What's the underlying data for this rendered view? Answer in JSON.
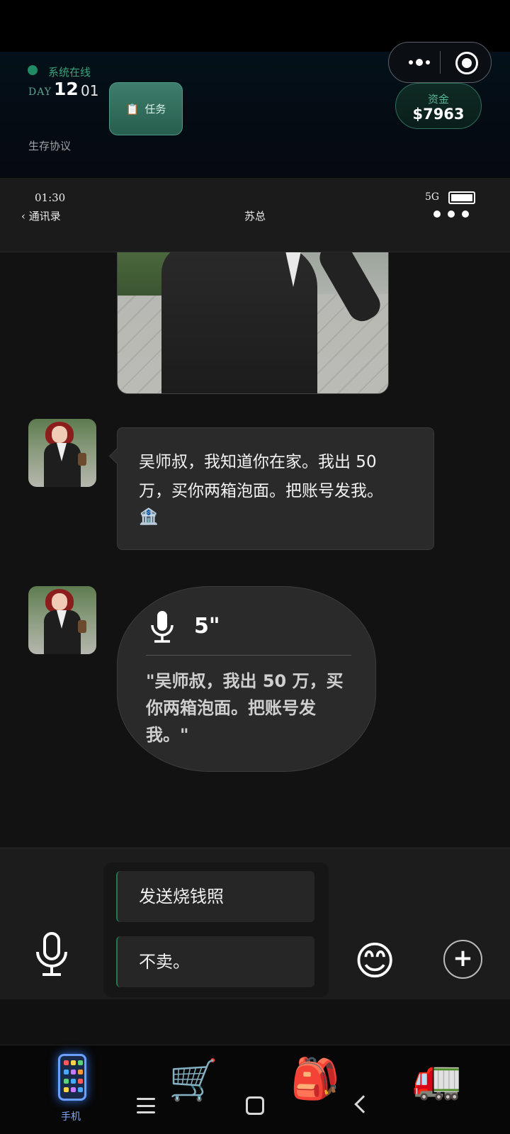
{
  "hud": {
    "status_text": "系统在线",
    "day_label": "DAY",
    "day_number": "12",
    "day_sub": "01",
    "task_icon": "📋",
    "task_label": "任务",
    "protocol_label": "生存协议",
    "funds_label": "资金",
    "funds_value": "$7963",
    "colors": {
      "online": "#1f8a63",
      "accent": "#3aa27a"
    }
  },
  "phone_status": {
    "time": "01:30",
    "network": "5G"
  },
  "chat_header": {
    "back_label": "‹ 通讯录",
    "contact_name": "苏总"
  },
  "chat": {
    "photo_save_icon": "💾",
    "messages": [
      {
        "type": "text",
        "text": "吴师叔，我知道你在家。我出 50 万，买你两箱泡面。把账号发我。",
        "icon": "🏦"
      },
      {
        "type": "voice",
        "duration": "5\"",
        "transcript": "\"吴师叔，我出 50 万，买你两箱泡面。把账号发我。\""
      }
    ]
  },
  "reply_options": [
    "发送烧钱照",
    "不卖。"
  ],
  "input_bar": {
    "emoji": "😊",
    "plus": "+"
  },
  "bottom_nav": {
    "phone_label": "手机",
    "shop_icon": "🛒",
    "backpack_icon": "🎒",
    "truck_icon": "🚛"
  }
}
